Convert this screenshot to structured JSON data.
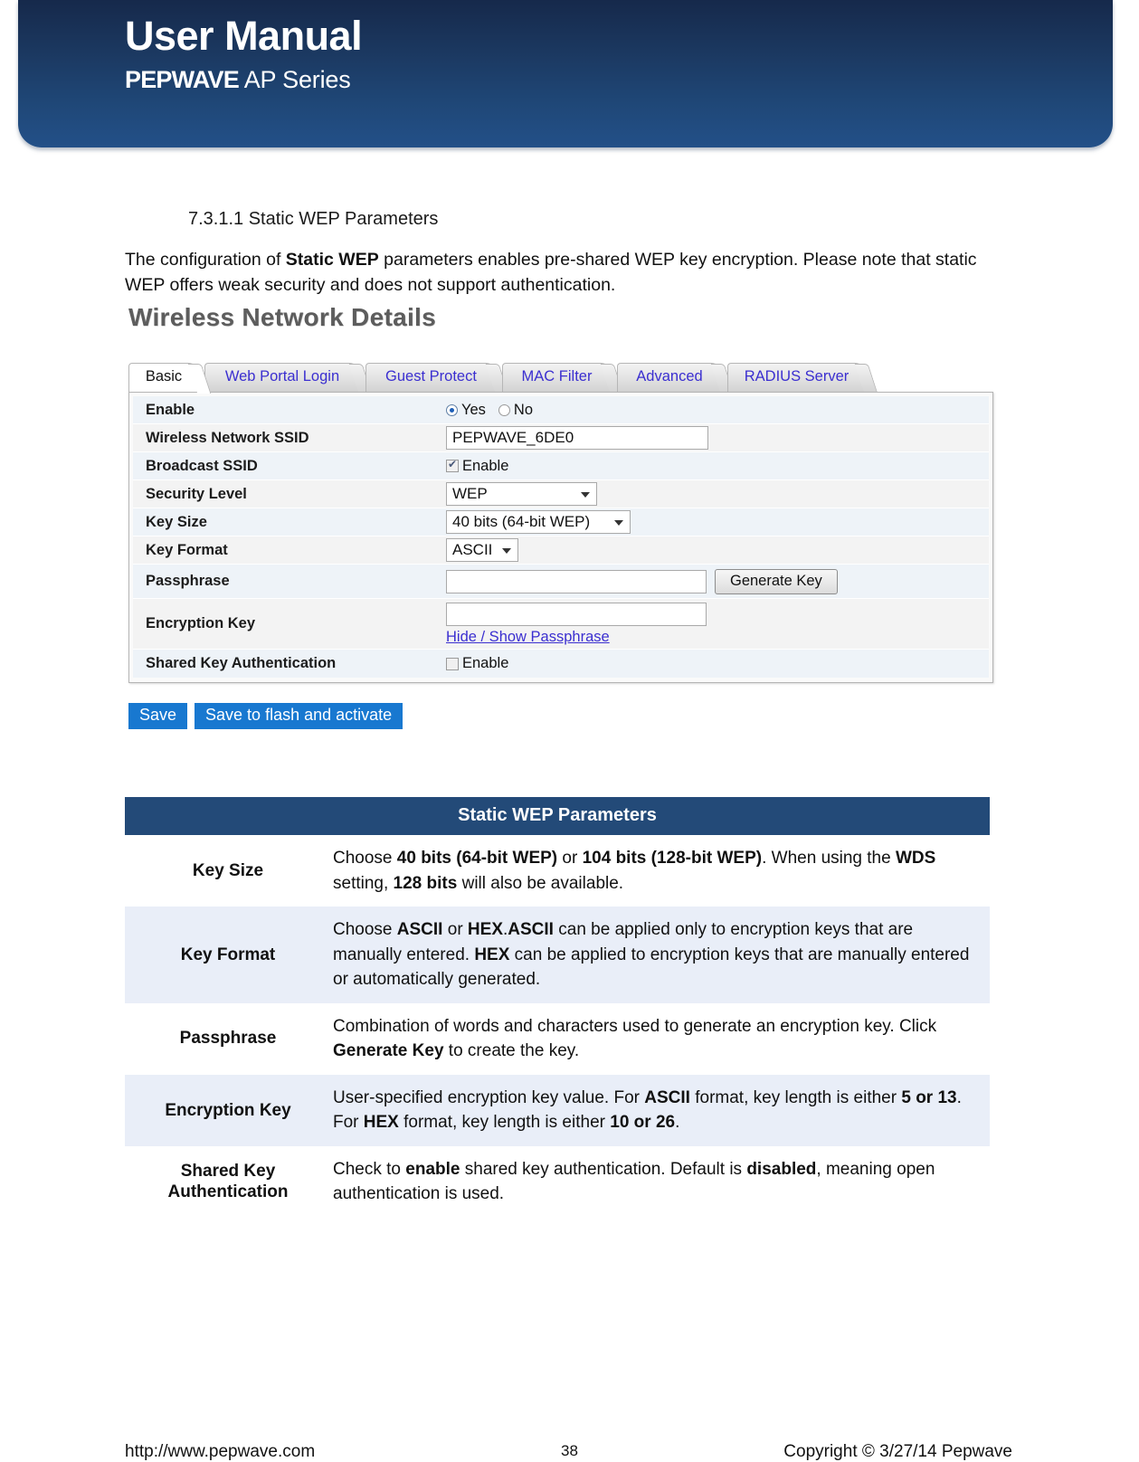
{
  "banner": {
    "title": "User Manual",
    "brand": "PEPWAVE",
    "series": " AP Series"
  },
  "section": {
    "heading": "7.3.1.1 Static WEP Parameters",
    "intro_part1": "The configuration of ",
    "intro_bold1": "Static WEP",
    "intro_part2": " parameters enables pre-shared WEP key encryption. Please note that static WEP offers weak security and does not support authentication."
  },
  "screenshot": {
    "title": "Wireless Network Details",
    "tabs": [
      {
        "label": "Basic",
        "active": true
      },
      {
        "label": "Web Portal Login",
        "active": false
      },
      {
        "label": "Guest Protect",
        "active": false
      },
      {
        "label": "MAC Filter",
        "active": false
      },
      {
        "label": "Advanced",
        "active": false
      },
      {
        "label": "RADIUS Server",
        "active": false
      }
    ],
    "rows": {
      "enable": {
        "label": "Enable",
        "yes": "Yes",
        "no": "No",
        "selected": "Yes"
      },
      "ssid": {
        "label": "Wireless Network SSID",
        "value": "PEPWAVE_6DE0",
        "placeholder": ""
      },
      "broadcast": {
        "label": "Broadcast SSID",
        "checkbox_label": "Enable",
        "checked": true
      },
      "security": {
        "label": "Security Level",
        "value": "WEP"
      },
      "keysize": {
        "label": "Key Size",
        "value": "40 bits (64-bit WEP)"
      },
      "keyformat": {
        "label": "Key Format",
        "value": "ASCII"
      },
      "passphrase": {
        "label": "Passphrase",
        "value": "",
        "placeholder": "",
        "button": "Generate Key"
      },
      "encryptionkey": {
        "label": "Encryption Key",
        "value": "",
        "placeholder": "",
        "link": "Hide / Show Passphrase"
      },
      "sharedkey": {
        "label": "Shared Key Authentication",
        "checkbox_label": "Enable",
        "checked": false
      }
    },
    "buttons": {
      "save": "Save",
      "save_flash": "Save to flash and activate"
    }
  },
  "params_table": {
    "title": "Static WEP Parameters",
    "rows": [
      {
        "name": "Key Size",
        "desc_html": "Choose <b>40 bits (64-bit WEP)</b> or <b>104 bits (128-bit WEP)</b>. When using the <b>WDS</b> setting, <b>128 bits</b> will also be available."
      },
      {
        "name": "Key Format",
        "desc_html": "Choose <b>ASCII</b> or <b>HEX</b>.<b>ASCII</b> can be applied only to encryption keys that are manually entered. <b>HEX</b> can be applied to encryption keys that are manually entered or automatically generated."
      },
      {
        "name": "Passphrase",
        "desc_html": "Combination of words and characters used to generate an encryption key. Click <b>Generate Key</b> to create the key."
      },
      {
        "name": "Encryption Key",
        "desc_html": "User-specified encryption key value. For <b>ASCII</b> format, key length is either <b>5 or 13</b>. For <b>HEX</b> format, key length is either <b>10 or 26</b>."
      },
      {
        "name": "Shared Key Authentication",
        "desc_html": "Check to <b>enable</b> shared key authentication. Default is <b>disabled</b>, meaning open authentication is used."
      }
    ]
  },
  "footer": {
    "url": "http://www.pepwave.com",
    "page": "38",
    "copyright": "Copyright © 3/27/14 Pepwave"
  },
  "colors": {
    "banner_top": "#16294b",
    "banner_bottom": "#235088",
    "table_header": "#234a78",
    "table_alt_row": "#e9eef8",
    "link": "#3b2fd0",
    "save_button": "#1878d0"
  }
}
